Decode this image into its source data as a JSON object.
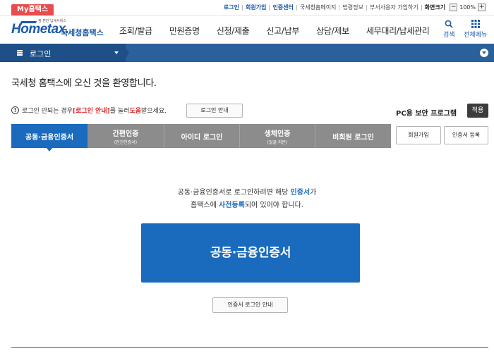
{
  "topbar": {
    "my_hometax": "My홈택스",
    "links": [
      "로그인",
      "회원가입",
      "인증센터",
      "국세청홈페이지",
      "법령정보",
      "부서사용자 가입하기"
    ],
    "screen_size_label": "화면크기",
    "zoom_minus": "−",
    "zoom_value": "100%",
    "zoom_plus": "+"
  },
  "header": {
    "logo_sub": "참 편한 납세서비스",
    "logo_main": "Hometax.",
    "logo_kr": "국세청홈택스",
    "nav": [
      "조회/발급",
      "민원증명",
      "신청/제출",
      "신고/납부",
      "상담/제보",
      "세무대리/납세관리"
    ],
    "search_label": "검색",
    "all_menu_label": "전체메뉴"
  },
  "bluebar": {
    "title": "로그인"
  },
  "main": {
    "welcome": "국세청 홈택스에 오신 것을 환영합니다.",
    "notice_prefix": "로그인 안되는 경우 ",
    "notice_red1": "[로그인 안내]",
    "notice_mid": "를 눌러 ",
    "notice_red2": "도움",
    "notice_suffix": "받으세요.",
    "login_guide_button": "로그인 안내",
    "pc_security_label": "PC용 보안 프로그램",
    "apply_button": "적용",
    "tabs": [
      {
        "label": "공동·금융인증서",
        "sub": ""
      },
      {
        "label": "간편인증",
        "sub": "(민간인증서)"
      },
      {
        "label": "아이디 로그인",
        "sub": ""
      },
      {
        "label": "생체인증",
        "sub": "(얼굴·지문)"
      },
      {
        "label": "비회원 로그인",
        "sub": ""
      }
    ],
    "signup_button": "회원가입",
    "cert_register_button": "인증서 등록",
    "desc1_a": "공동·금융인증서로 로그인하려면 해당 ",
    "desc1_b": "인증서",
    "desc1_c": "가",
    "desc2_a": "홈택스에 ",
    "desc2_b": "사전등록",
    "desc2_c": "되어 있어야 합니다.",
    "big_button": "공동·금융인증서",
    "cert_login_guide_button": "인증서 로그인 안내"
  },
  "colors": {
    "brand_blue": "#1a6bbd",
    "navy_bar": "#1e4f86",
    "alert_red": "#d62b2b",
    "tab_gray": "#8c8c8c"
  }
}
